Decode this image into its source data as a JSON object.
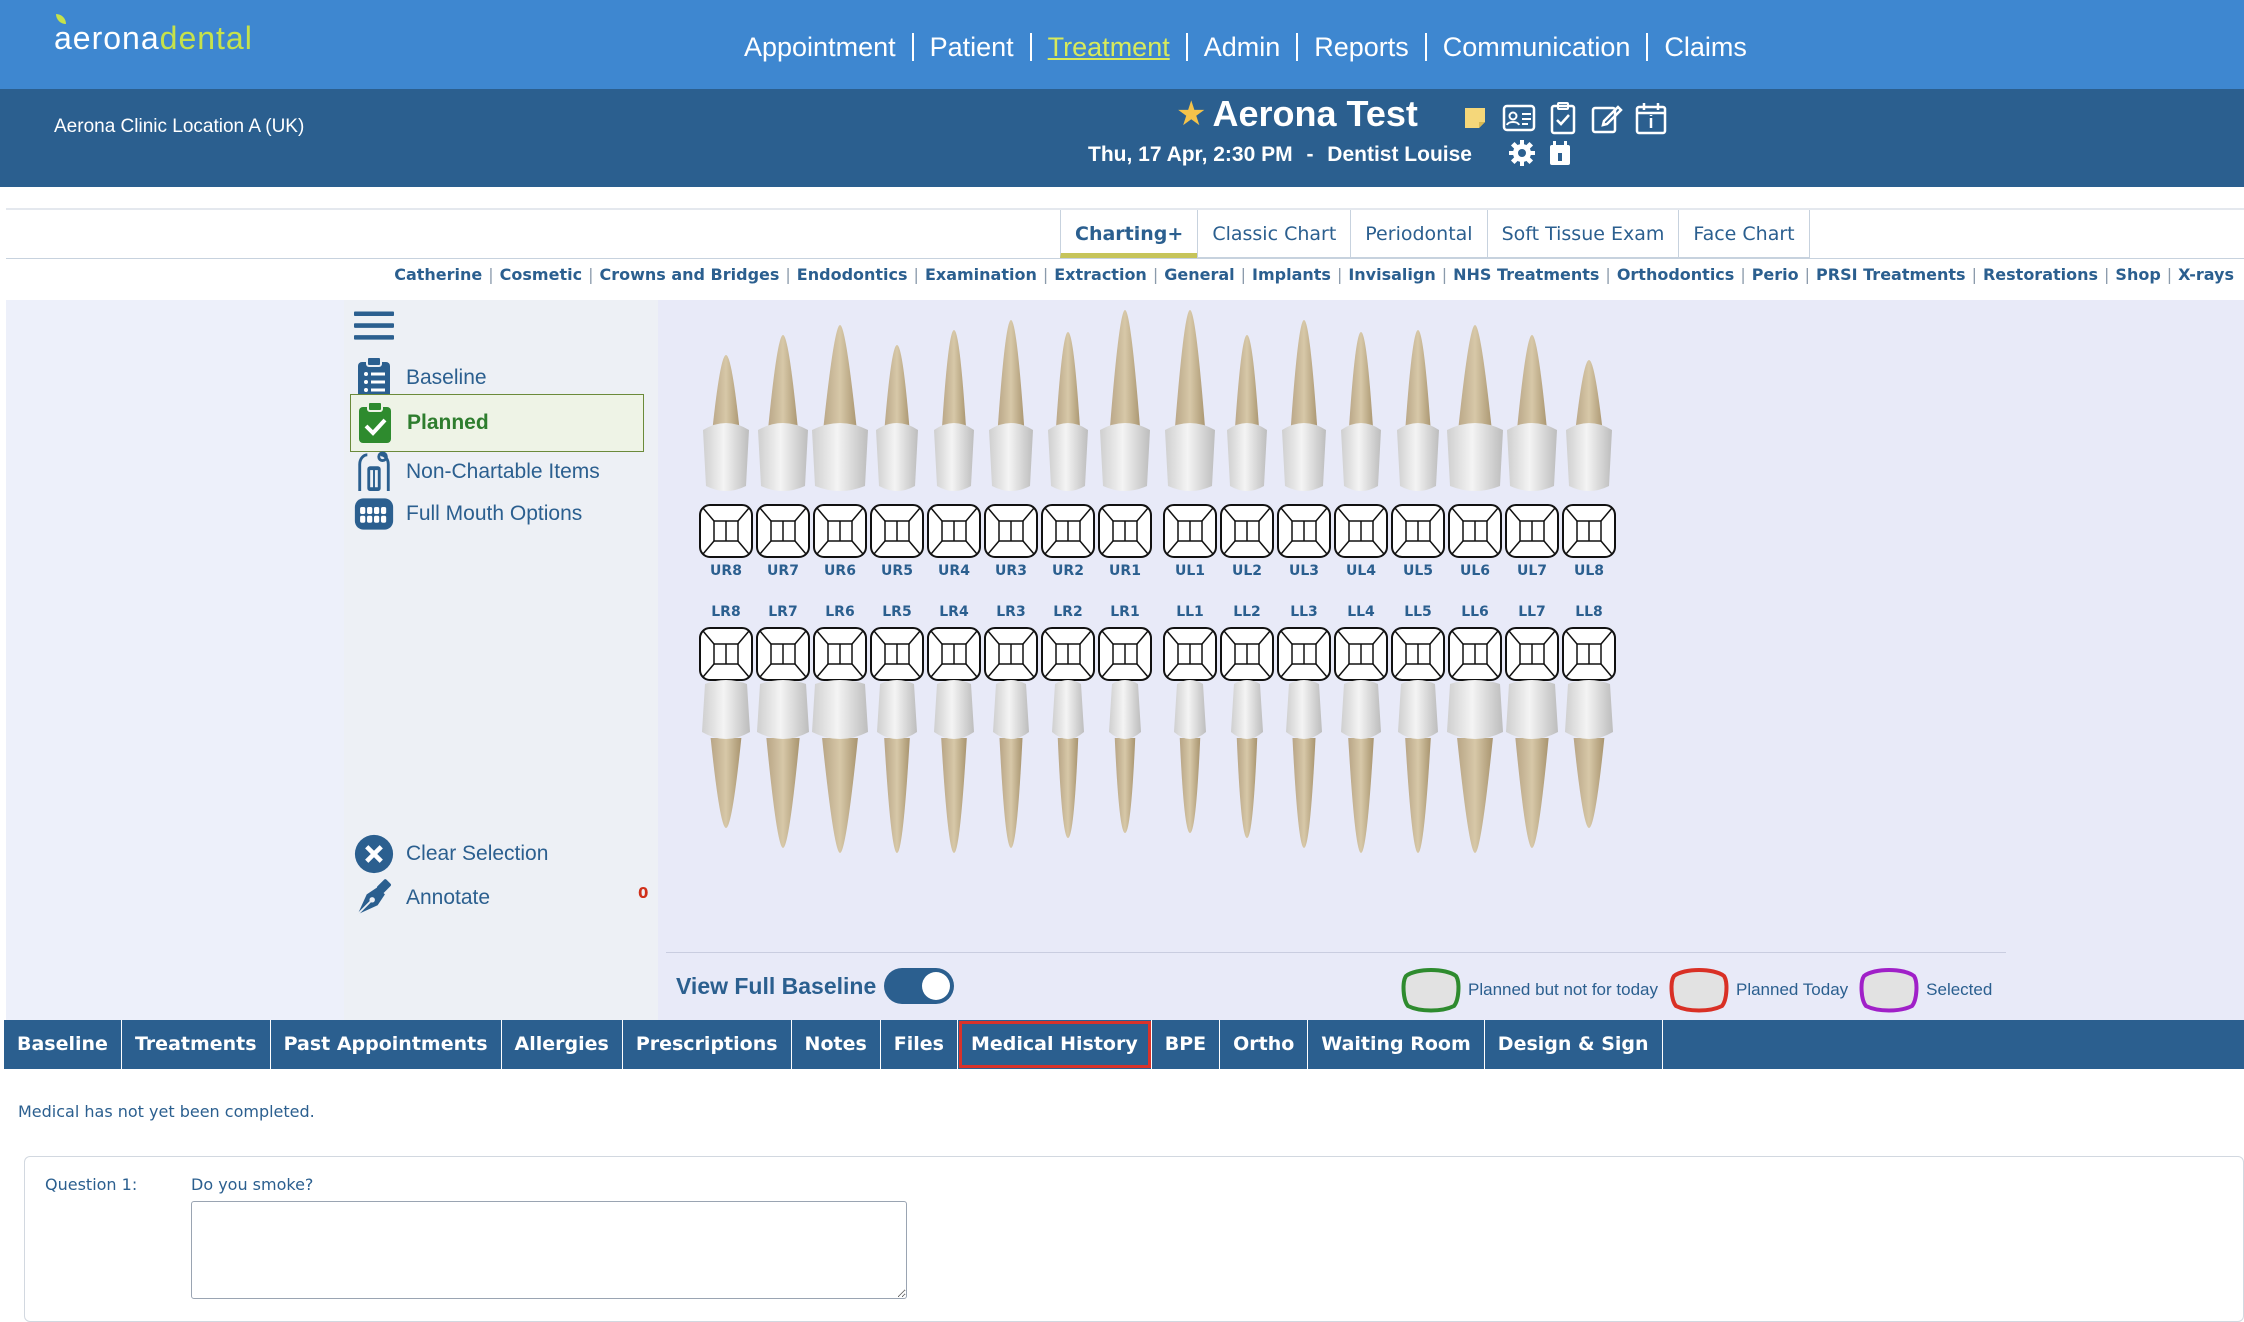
{
  "brand": {
    "logo_main": "aerona",
    "logo_accent": "dental"
  },
  "topnav": {
    "items": [
      {
        "label": "Appointment",
        "active": false
      },
      {
        "label": "Patient",
        "active": false
      },
      {
        "label": "Treatment",
        "active": true
      },
      {
        "label": "Admin",
        "active": false
      },
      {
        "label": "Reports",
        "active": false
      },
      {
        "label": "Communication",
        "active": false
      },
      {
        "label": "Claims",
        "active": false
      }
    ]
  },
  "patient_bar": {
    "clinic": "Aerona Clinic Location A (UK)",
    "patient_name": "Aerona Test",
    "appointment_time": "Thu, 17 Apr, 2:30 PM",
    "dash": "-",
    "dentist": "Dentist Louise",
    "icons": [
      "sticky-note-icon",
      "id-card-icon",
      "clipboard-check-icon",
      "edit-icon",
      "calendar-info-icon"
    ]
  },
  "chart_tabs": [
    {
      "label": "Charting+",
      "active": true
    },
    {
      "label": "Classic Chart",
      "active": false
    },
    {
      "label": "Periodontal",
      "active": false
    },
    {
      "label": "Soft Tissue Exam",
      "active": false
    },
    {
      "label": "Face Chart",
      "active": false
    }
  ],
  "categories": [
    "Catherine",
    "Cosmetic",
    "Crowns and Bridges",
    "Endodontics",
    "Examination",
    "Extraction",
    "General",
    "Implants",
    "Invisalign",
    "NHS Treatments",
    "Orthodontics",
    "Perio",
    "PRSI Treatments",
    "Restorations",
    "Shop",
    "X-rays"
  ],
  "category_separator": "|",
  "tools": {
    "baseline": "Baseline",
    "planned": "Planned",
    "non_chartable": "Non-Chartable Items",
    "full_mouth": "Full Mouth Options",
    "clear_selection": "Clear Selection",
    "annotate": "Annotate",
    "counter": "0"
  },
  "teeth": {
    "upper": [
      "UR8",
      "UR7",
      "UR6",
      "UR5",
      "UR4",
      "UR3",
      "UR2",
      "UR1",
      "UL1",
      "UL2",
      "UL3",
      "UL4",
      "UL5",
      "UL6",
      "UL7",
      "UL8"
    ],
    "lower": [
      "LR8",
      "LR7",
      "LR6",
      "LR5",
      "LR4",
      "LR3",
      "LR2",
      "LR1",
      "LL1",
      "LL2",
      "LL3",
      "LL4",
      "LL5",
      "LL6",
      "LL7",
      "LL8"
    ]
  },
  "view_full_baseline": {
    "label": "View Full Baseline",
    "on": true
  },
  "legend": [
    {
      "label": "Planned but not for today",
      "color": "#2e8b2e"
    },
    {
      "label": "Planned Today",
      "color": "#d93025"
    },
    {
      "label": "Selected",
      "color": "#a020c8"
    }
  ],
  "bottom_tabs": [
    {
      "label": "Baseline",
      "active": false
    },
    {
      "label": "Treatments",
      "active": false
    },
    {
      "label": "Past Appointments",
      "active": false
    },
    {
      "label": "Allergies",
      "active": false
    },
    {
      "label": "Prescriptions",
      "active": false
    },
    {
      "label": "Notes",
      "active": false
    },
    {
      "label": "Files",
      "active": false
    },
    {
      "label": "Medical History",
      "active": true
    },
    {
      "label": "BPE",
      "active": false
    },
    {
      "label": "Ortho",
      "active": false
    },
    {
      "label": "Waiting Room",
      "active": false
    },
    {
      "label": "Design & Sign",
      "active": false
    }
  ],
  "medical_history": {
    "status_note": "Medical has not yet been completed.",
    "question_label": "Question 1:",
    "question_text": "Do you smoke?",
    "answer_value": ""
  },
  "colors": {
    "nav": "#3e87d0",
    "patbar": "#2b5f8f",
    "accent": "#c6e24a",
    "text": "#2b5f8f"
  }
}
